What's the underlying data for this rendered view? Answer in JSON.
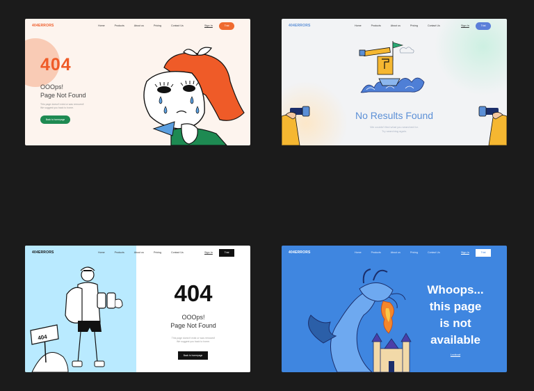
{
  "cards": {
    "a": {
      "logo": "404ERRORS",
      "nav": [
        "Home",
        "Products",
        "About us",
        "Pricing",
        "Contact Us"
      ],
      "signin": "Sign In",
      "cta": "Trial",
      "heading": "404",
      "title_line1": "OOOps!",
      "title_line2": "Page Not Found",
      "desc_line1": "This page doesn't exist or was removed!",
      "desc_line2": "We suggest you back to home.",
      "button": "Back to homepage",
      "colors": {
        "accent": "#ef5b28",
        "button": "#1e8a52"
      }
    },
    "b": {
      "logo": "404ERRORS",
      "nav": [
        "Home",
        "Products",
        "About us",
        "Pricing",
        "Contact Us"
      ],
      "signin": "Sign In",
      "cta": "Trial",
      "title": "No Results Found",
      "desc_line1": "We couldn't find what you searched for.",
      "desc_line2": "Try searching again.",
      "colors": {
        "accent": "#5b8fd6"
      }
    },
    "c": {
      "logo": "404ERRORS",
      "nav": [
        "Home",
        "Products",
        "About us",
        "Pricing",
        "Contact Us"
      ],
      "signin": "Sign In",
      "cta": "Trial",
      "heading": "404",
      "title_line1": "OOOps!",
      "title_line2": "Page Not Found",
      "desc_line1": "This page doesn't exist or was removed!",
      "desc_line2": "We suggest you back to home.",
      "button": "Back to homepage",
      "sign_text": "404",
      "colors": {
        "panel": "#b9eaff"
      }
    },
    "d": {
      "logo": "404ERRORS",
      "nav": [
        "Home",
        "Products",
        "About us",
        "Pricing",
        "Contact Us"
      ],
      "signin": "Sign In",
      "cta": "Trial",
      "line1": "Whoops...",
      "line2": "this page",
      "line3": "is not",
      "line4": "available",
      "link": "Lookout",
      "colors": {
        "background": "#3f86e0"
      }
    }
  }
}
